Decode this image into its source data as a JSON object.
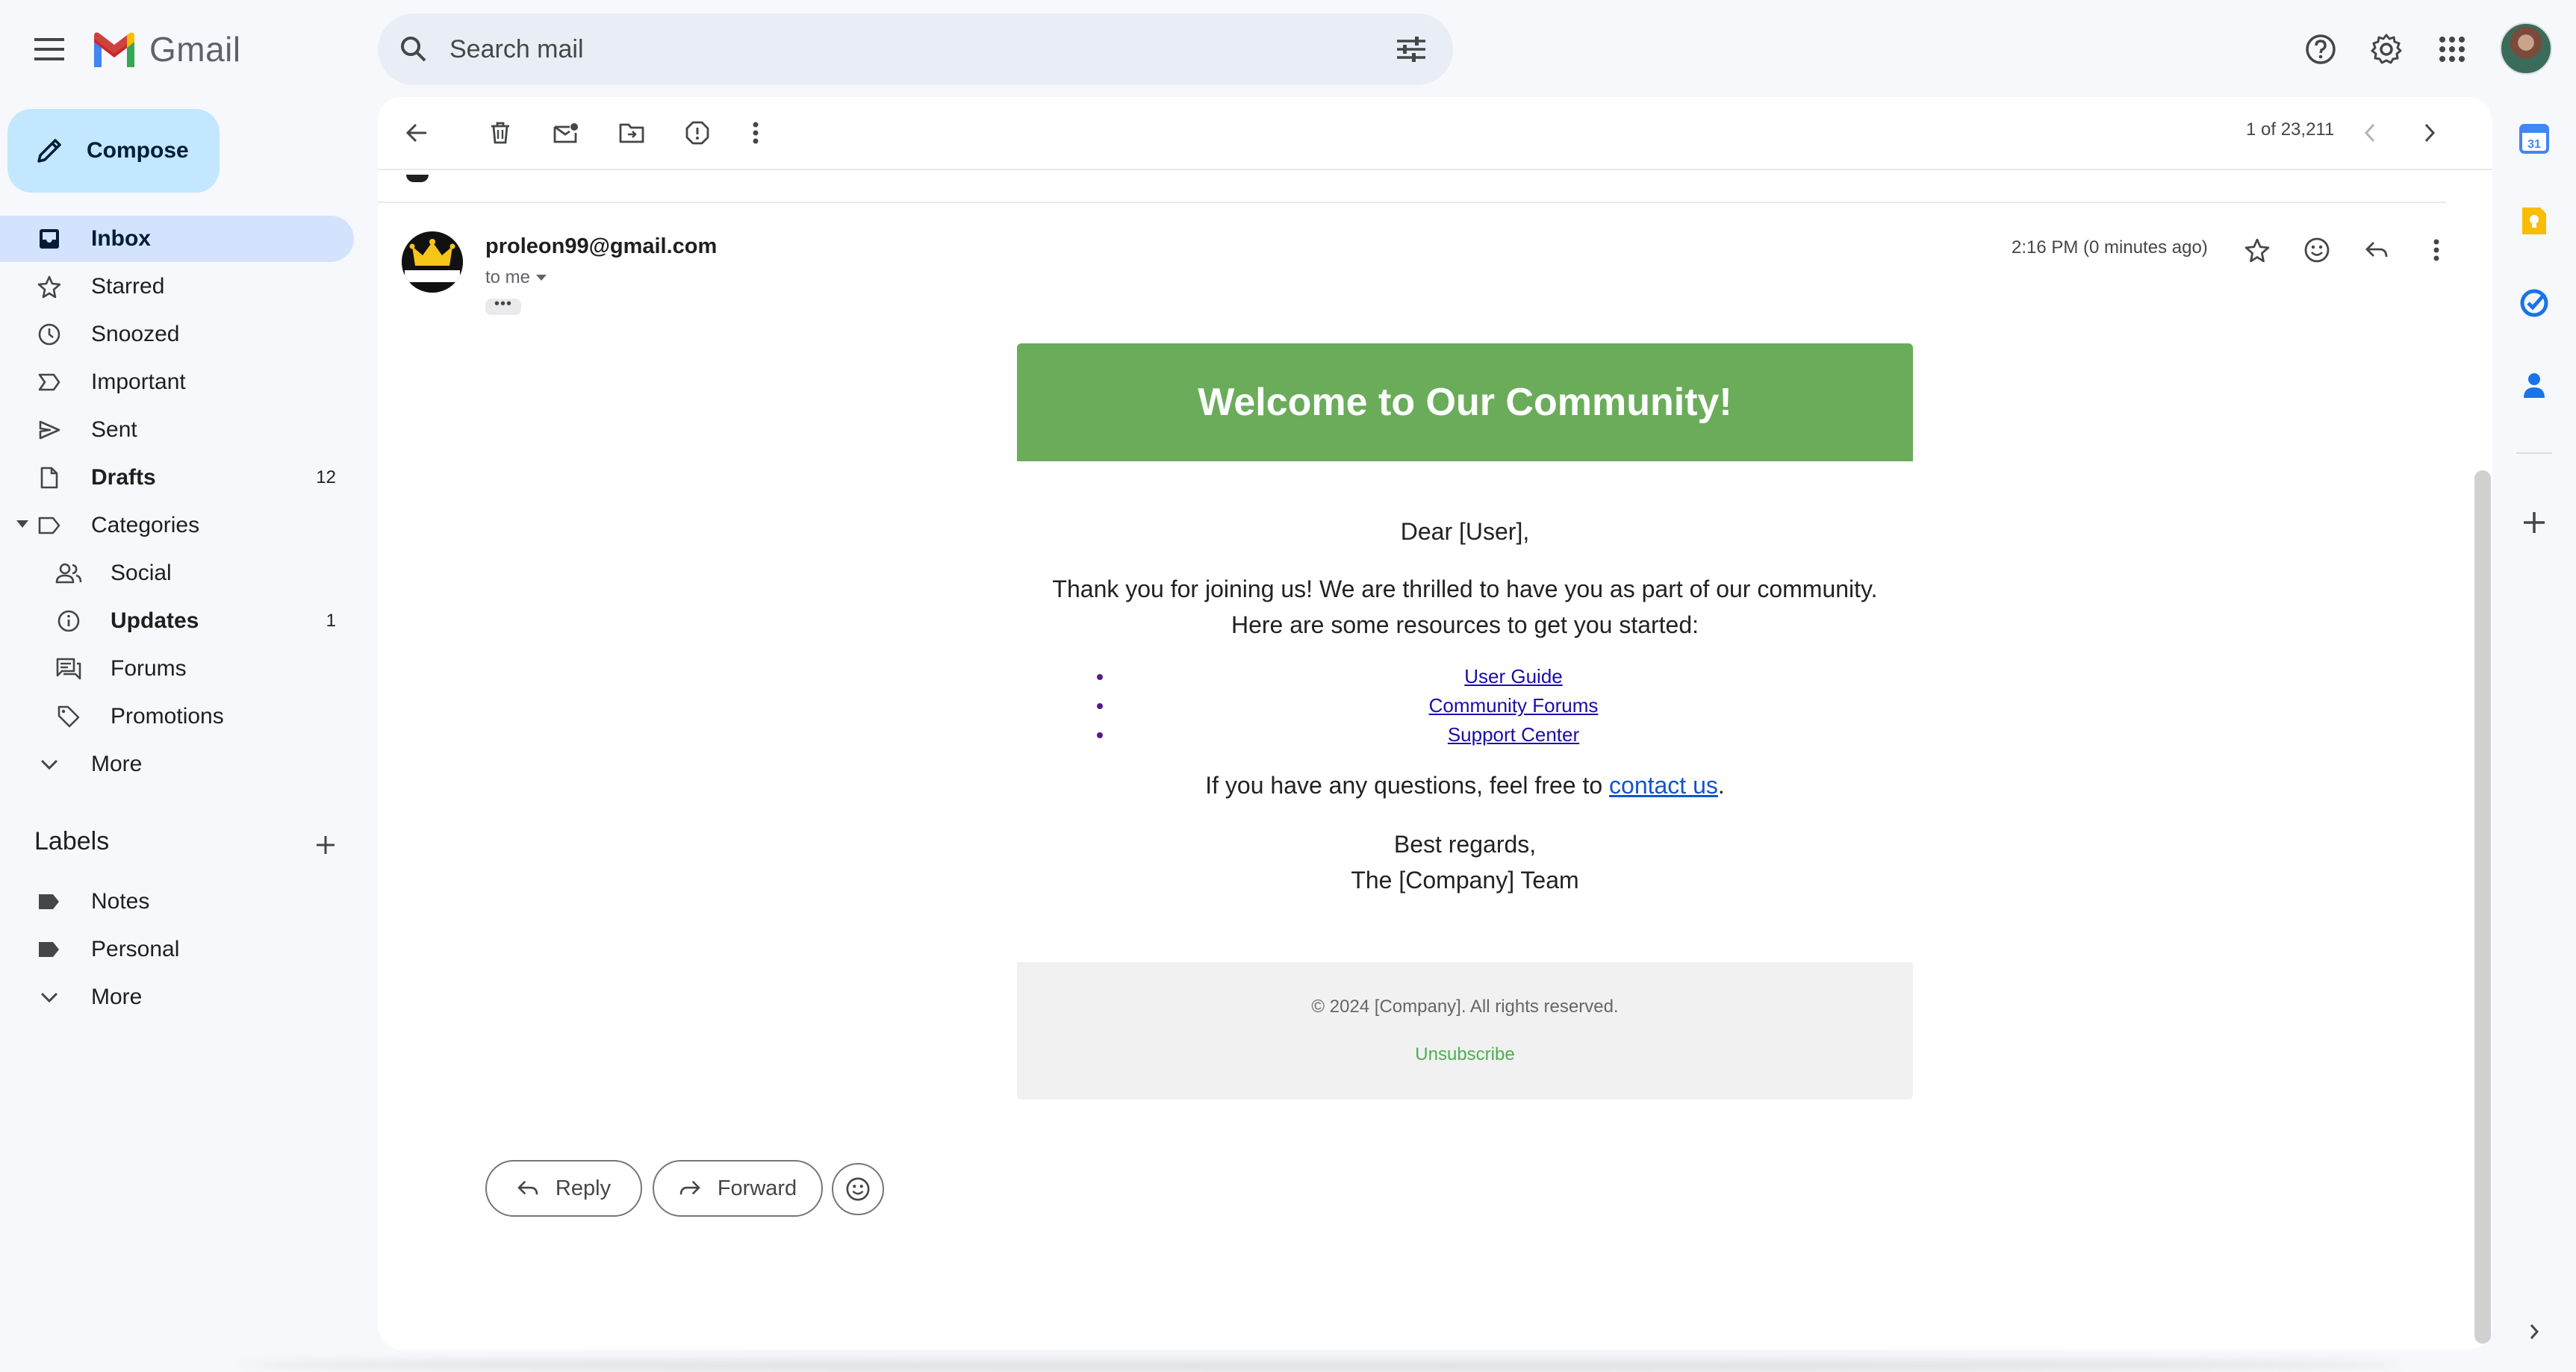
{
  "header": {
    "app_name": "Gmail",
    "search_placeholder": "Search mail"
  },
  "compose": {
    "label": "Compose"
  },
  "sidebar": {
    "items": [
      {
        "label": "Inbox",
        "count": "",
        "icon": "inbox-icon",
        "active": true
      },
      {
        "label": "Starred",
        "count": "",
        "icon": "star-icon"
      },
      {
        "label": "Snoozed",
        "count": "",
        "icon": "clock-icon"
      },
      {
        "label": "Important",
        "count": "",
        "icon": "important-icon"
      },
      {
        "label": "Sent",
        "count": "",
        "icon": "send-icon"
      },
      {
        "label": "Drafts",
        "count": "12",
        "icon": "draft-icon",
        "bold": true
      },
      {
        "label": "Categories",
        "count": "",
        "icon": "label-icon"
      },
      {
        "label": "Social",
        "count": "",
        "icon": "people-icon"
      },
      {
        "label": "Updates",
        "count": "1",
        "icon": "info-icon",
        "bold": true
      },
      {
        "label": "Forums",
        "count": "",
        "icon": "forum-icon"
      },
      {
        "label": "Promotions",
        "count": "",
        "icon": "tag-icon"
      },
      {
        "label": "More",
        "count": "",
        "icon": "chevron-down-icon"
      }
    ],
    "labels_title": "Labels",
    "labels": [
      {
        "label": "Notes",
        "icon": "label-filled-icon"
      },
      {
        "label": "Personal",
        "icon": "label-filled-icon"
      },
      {
        "label": "More",
        "icon": "chevron-down-icon"
      }
    ]
  },
  "toolbar": {
    "pager": "1 of 23,211"
  },
  "message": {
    "sender": "proleon99@gmail.com",
    "to": "to me",
    "timestamp": "2:16 PM (0 minutes ago)",
    "ellipsis": "•••"
  },
  "email": {
    "heading": "Welcome to Our Community!",
    "greeting": "Dear [User],",
    "intro_line1": "Thank you for joining us! We are thrilled to have you as part of our community.",
    "intro_line2": "Here are some resources to get you started:",
    "links": [
      "User Guide",
      "Community Forums",
      "Support Center"
    ],
    "questions_prefix": "If you have any questions, feel free to ",
    "questions_link": "contact us",
    "questions_suffix": ".",
    "regards_line1": "Best regards,",
    "regards_line2": "The [Company] Team",
    "copyright": "© 2024 [Company]. All rights reserved.",
    "unsubscribe": "Unsubscribe",
    "colors": {
      "hero": "#6aac5a",
      "unsubscribe": "#4caf50"
    }
  },
  "actions": {
    "reply": "Reply",
    "forward": "Forward"
  }
}
